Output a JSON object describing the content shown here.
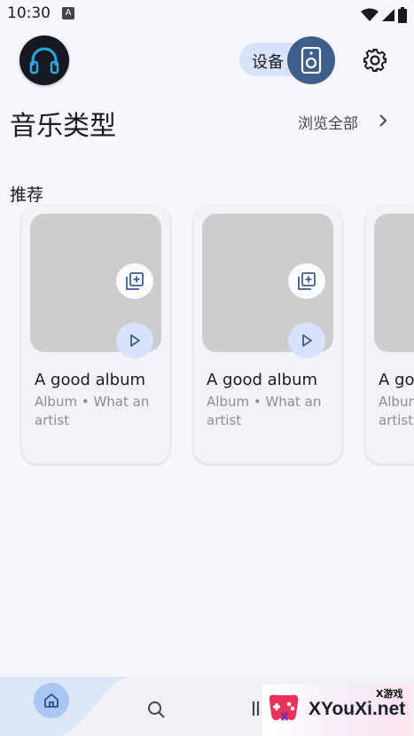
{
  "status_bar": {
    "time": "10:30",
    "notification_badge": "A",
    "icons": [
      "wifi-icon",
      "cellular-icon",
      "battery-icon"
    ]
  },
  "header": {
    "device_label": "设备",
    "icons": [
      "app-logo-headphones-icon",
      "speaker-icon",
      "gear-icon"
    ]
  },
  "section": {
    "title": "音乐类型",
    "browse_all": "浏览全部"
  },
  "recommended": {
    "title": "推荐",
    "cards": [
      {
        "title": "A good album",
        "subtitle": "Album • What an artist"
      },
      {
        "title": "A good album",
        "subtitle": "Album • What an artist"
      },
      {
        "title": "A good album",
        "subtitle": "Album • What an artist"
      }
    ]
  },
  "bottom_nav": {
    "items": [
      "home-icon",
      "search-icon",
      "library-icon"
    ]
  },
  "watermark": {
    "small_text": "X游戏",
    "big_text": "XYouXi.net"
  },
  "colors": {
    "background": "#f6f7fd",
    "accent": "#3e5f8a",
    "pill": "#d6e3fb",
    "placeholder": "#cdcdcd"
  }
}
